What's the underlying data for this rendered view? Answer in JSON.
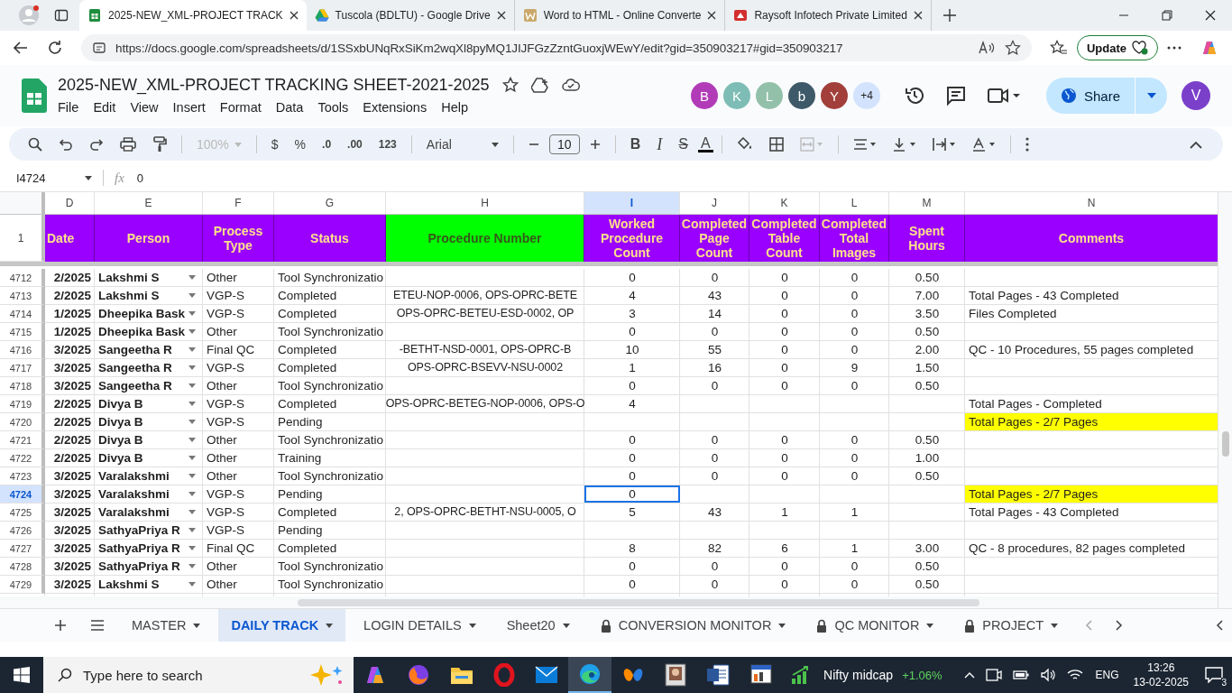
{
  "browser": {
    "tabs": [
      {
        "title": "2025-NEW_XML-PROJECT TRACK",
        "kind": "sheet",
        "selected": true
      },
      {
        "title": "Tuscola (BDLTU) - Google Drive",
        "kind": "drive",
        "selected": false
      },
      {
        "title": "Word to HTML - Online Converte",
        "kind": "doc",
        "selected": false
      },
      {
        "title": "Raysoft Infotech Private Limited",
        "kind": "logo",
        "selected": false
      }
    ],
    "url": "https://docs.google.com/spreadsheets/d/1SSxbUNqRxSiKm2wqXl8pyMQ1JIJFGzZzntGuoxjWEwY/edit?gid=350903217#gid=350903217",
    "update_button": "Update"
  },
  "sheet_header": {
    "title": "2025-NEW_XML-PROJECT TRACKING SHEET-2021-2025",
    "menu": [
      "File",
      "Edit",
      "View",
      "Insert",
      "Format",
      "Data",
      "Tools",
      "Extensions",
      "Help"
    ],
    "collaborators": [
      {
        "initial": "B",
        "color": "#b23cb8"
      },
      {
        "initial": "K",
        "color": "#7dbdb5"
      },
      {
        "initial": "L",
        "color": "#93c0a9"
      },
      {
        "initial": "b",
        "color": "#3e5a69"
      },
      {
        "initial": "Y",
        "color": "#a23f3a"
      }
    ],
    "more_collaborators": "+4",
    "share_button": "Share",
    "account_initial": "V"
  },
  "toolbar": {
    "zoom": {
      "value": "100%",
      "disabled": true
    },
    "currency": "$",
    "percent": "%",
    "decrease_decimals": ".0",
    "increase_decimals": ".00",
    "number_format": "123",
    "font": "Arial",
    "font_size": "10",
    "bold": "B",
    "italic": "I",
    "strikethrough": "S",
    "text_color": "A"
  },
  "formula_bar": {
    "cell_ref": "I4724",
    "fx": "fx",
    "value": "0"
  },
  "grid": {
    "columns": [
      {
        "letter": "D",
        "title": "Date",
        "color": "#9900ff",
        "selected": false
      },
      {
        "letter": "E",
        "title": "Person",
        "color": "#9900ff",
        "selected": false
      },
      {
        "letter": "F",
        "title": "Process Type",
        "color": "#9900ff",
        "selected": false
      },
      {
        "letter": "G",
        "title": "Status",
        "color": "#9900ff",
        "selected": false
      },
      {
        "letter": "H",
        "title": "Procedure Number",
        "color": "#00ff00",
        "selected": false
      },
      {
        "letter": "I",
        "title": "Worked Procedure Count",
        "color": "#9900ff",
        "selected": true
      },
      {
        "letter": "J",
        "title": "Completed Page Count",
        "color": "#9900ff",
        "selected": false
      },
      {
        "letter": "K",
        "title": "Completed Table Count",
        "color": "#9900ff",
        "selected": false
      },
      {
        "letter": "L",
        "title": "Completed Total Images",
        "color": "#9900ff",
        "selected": false
      },
      {
        "letter": "M",
        "title": "Spent Hours",
        "color": "#9900ff",
        "selected": false
      },
      {
        "letter": "N",
        "title": "Comments",
        "color": "#9900ff",
        "selected": false
      }
    ],
    "header_row_number": "1",
    "rows": [
      {
        "number": "4712",
        "date": "2/2025",
        "person": "Lakshmi S",
        "type": "Other",
        "status": "Tool Synchronizatio",
        "worked": "0",
        "pages": "0",
        "tables": "0",
        "images": "0",
        "hours": "0.50",
        "highlight": false,
        "selected": false
      },
      {
        "number": "4713",
        "date": "2/2025",
        "person": "Lakshmi S",
        "type": "VGP-S",
        "status": "Completed",
        "procedure": "ETEU-NOP-0006, OPS-OPRC-BETE",
        "worked": "4",
        "pages": "43",
        "tables": "0",
        "images": "0",
        "hours": "7.00",
        "comment": "Total Pages - 43 Completed",
        "highlight": false,
        "selected": false
      },
      {
        "number": "4714",
        "date": "1/2025",
        "person": "Dheepika Bask",
        "type": "VGP-S",
        "status": "Completed",
        "procedure": "OPS-OPRC-BETEU-ESD-0002, OP",
        "worked": "3",
        "pages": "14",
        "tables": "0",
        "images": "0",
        "hours": "3.50",
        "comment": "Files Completed",
        "highlight": false,
        "selected": false
      },
      {
        "number": "4715",
        "date": "1/2025",
        "person": "Dheepika Bask",
        "type": "Other",
        "status": "Tool Synchronizatio",
        "worked": "0",
        "pages": "0",
        "tables": "0",
        "images": "0",
        "hours": "0.50",
        "highlight": false,
        "selected": false
      },
      {
        "number": "4716",
        "date": "3/2025",
        "person": "Sangeetha R",
        "type": "Final QC",
        "status": "Completed",
        "procedure": "-BETHT-NSD-0001, OPS-OPRC-B",
        "worked": "10",
        "pages": "55",
        "tables": "0",
        "images": "0",
        "hours": "2.00",
        "comment": "QC - 10 Procedures, 55 pages completed",
        "highlight": false,
        "selected": false
      },
      {
        "number": "4717",
        "date": "3/2025",
        "person": "Sangeetha R",
        "type": "VGP-S",
        "status": "Completed",
        "procedure": "OPS-OPRC-BSEVV-NSU-0002",
        "worked": "1",
        "pages": "16",
        "tables": "0",
        "images": "9",
        "hours": "1.50",
        "highlight": false,
        "selected": false
      },
      {
        "number": "4718",
        "date": "3/2025",
        "person": "Sangeetha R",
        "type": "Other",
        "status": "Tool Synchronizatio",
        "worked": "0",
        "pages": "0",
        "tables": "0",
        "images": "0",
        "hours": "0.50",
        "highlight": false,
        "selected": false
      },
      {
        "number": "4719",
        "date": "2/2025",
        "person": "Divya B",
        "type": "VGP-S",
        "status": "Completed",
        "procedure": "OPS-OPRC-BETEG-NOP-0006, OPS-O",
        "worked": "4",
        "comment": "Total Pages - Completed",
        "highlight": false,
        "selected": false
      },
      {
        "number": "4720",
        "date": "2/2025",
        "person": "Divya B",
        "type": "VGP-S",
        "status": "Pending",
        "comment": "Total Pages - 2/7 Pages",
        "highlight": true,
        "selected": false
      },
      {
        "number": "4721",
        "date": "2/2025",
        "person": "Divya B",
        "type": "Other",
        "status": "Tool Synchronizatio",
        "worked": "0",
        "pages": "0",
        "tables": "0",
        "images": "0",
        "hours": "0.50",
        "highlight": false,
        "selected": false
      },
      {
        "number": "4722",
        "date": "2/2025",
        "person": "Divya B",
        "type": "Other",
        "status": "Training",
        "worked": "0",
        "pages": "0",
        "tables": "0",
        "images": "0",
        "hours": "1.00",
        "highlight": false,
        "selected": false
      },
      {
        "number": "4723",
        "date": "3/2025",
        "person": "Varalakshmi",
        "type": "Other",
        "status": "Tool Synchronizatio",
        "worked": "0",
        "pages": "0",
        "tables": "0",
        "images": "0",
        "hours": "0.50",
        "highlight": false,
        "selected": false
      },
      {
        "number": "4724",
        "date": "3/2025",
        "person": "Varalakshmi",
        "type": "VGP-S",
        "status": "Pending",
        "worked": "0",
        "comment": "Total Pages - 2/7 Pages",
        "highlight": true,
        "selected": true
      },
      {
        "number": "4725",
        "date": "3/2025",
        "person": "Varalakshmi",
        "type": "VGP-S",
        "status": "Completed",
        "procedure": "2, OPS-OPRC-BETHT-NSU-0005, O",
        "worked": "5",
        "pages": "43",
        "tables": "1",
        "images": "1",
        "comment": "Total Pages - 43 Completed",
        "highlight": false,
        "selected": false
      },
      {
        "number": "4726",
        "date": "3/2025",
        "person": "SathyaPriya R",
        "type": "VGP-S",
        "status": "Pending",
        "highlight": false,
        "selected": false
      },
      {
        "number": "4727",
        "date": "3/2025",
        "person": "SathyaPriya R",
        "type": "Final QC",
        "status": "Completed",
        "worked": "8",
        "pages": "82",
        "tables": "6",
        "images": "1",
        "hours": "3.00",
        "comment": "QC - 8 procedures, 82 pages completed",
        "highlight": false,
        "selected": false
      },
      {
        "number": "4728",
        "date": "3/2025",
        "person": "SathyaPriya R",
        "type": "Other",
        "status": "Tool Synchronizatio",
        "worked": "0",
        "pages": "0",
        "tables": "0",
        "images": "0",
        "hours": "0.50",
        "highlight": false,
        "selected": false
      },
      {
        "number": "4729",
        "date": "3/2025",
        "person": "Lakshmi S",
        "type": "Other",
        "status": "Tool Synchronizatio",
        "worked": "0",
        "pages": "0",
        "tables": "0",
        "images": "0",
        "hours": "0.50",
        "highlight": false,
        "selected": false
      }
    ]
  },
  "sheet_tabs": [
    {
      "name": "MASTER",
      "locked": false,
      "selected": false
    },
    {
      "name": "DAILY TRACK",
      "locked": false,
      "selected": true
    },
    {
      "name": "LOGIN DETAILS",
      "locked": false,
      "selected": false
    },
    {
      "name": "Sheet20",
      "locked": false,
      "selected": false
    },
    {
      "name": "CONVERSION MONITOR",
      "locked": true,
      "selected": false
    },
    {
      "name": "QC MONITOR",
      "locked": true,
      "selected": false
    },
    {
      "name": "PROJECT",
      "locked": true,
      "selected": false
    }
  ],
  "taskbar": {
    "search_placeholder": "Type here to search",
    "ticker_name": "Nifty midcap",
    "ticker_change": "+1.06%",
    "language": "ENG",
    "time": "13:26",
    "date": "13-02-2025",
    "notifications": "3"
  }
}
